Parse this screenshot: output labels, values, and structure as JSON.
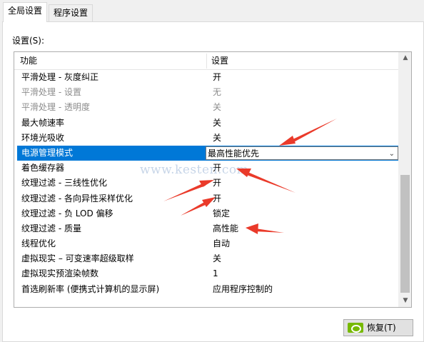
{
  "tabs": [
    {
      "label": "全局设置"
    },
    {
      "label": "程序设置"
    }
  ],
  "settings_label": "设置(S):",
  "table": {
    "headers": {
      "feature": "功能",
      "setting": "设置"
    },
    "rows": [
      {
        "name": "平滑处理 - 灰度纠正",
        "value": "开"
      },
      {
        "name": "平滑处理 - 设置",
        "value": "无"
      },
      {
        "name": "平滑处理 - 透明度",
        "value": "关"
      },
      {
        "name": "最大帧速率",
        "value": "关"
      },
      {
        "name": "环境光吸收",
        "value": "关"
      },
      {
        "name": "电源管理模式",
        "value": "最高性能优先"
      },
      {
        "name": "着色缓存器",
        "value": "开"
      },
      {
        "name": "纹理过滤 - 三线性优化",
        "value": "开"
      },
      {
        "name": "纹理过滤 - 各向异性采样优化",
        "value": "开"
      },
      {
        "name": "纹理过滤 - 负 LOD 偏移",
        "value": "锁定"
      },
      {
        "name": "纹理过滤 - 质量",
        "value": "高性能"
      },
      {
        "name": "线程优化",
        "value": "自动"
      },
      {
        "name": "虚拟现实 – 可变速率超级取样",
        "value": "关"
      },
      {
        "name": "虚拟现实预渲染帧数",
        "value": "1"
      },
      {
        "name": "首选刷新率 (便携式计算机的显示屏)",
        "value": "应用程序控制的"
      }
    ]
  },
  "watermark": "www.kesten.com",
  "restore_button": {
    "label": "恢复(T)"
  },
  "colors": {
    "selection": "#0078d7",
    "arrow": "#ea3a2a",
    "nvidia": "#76b900"
  }
}
